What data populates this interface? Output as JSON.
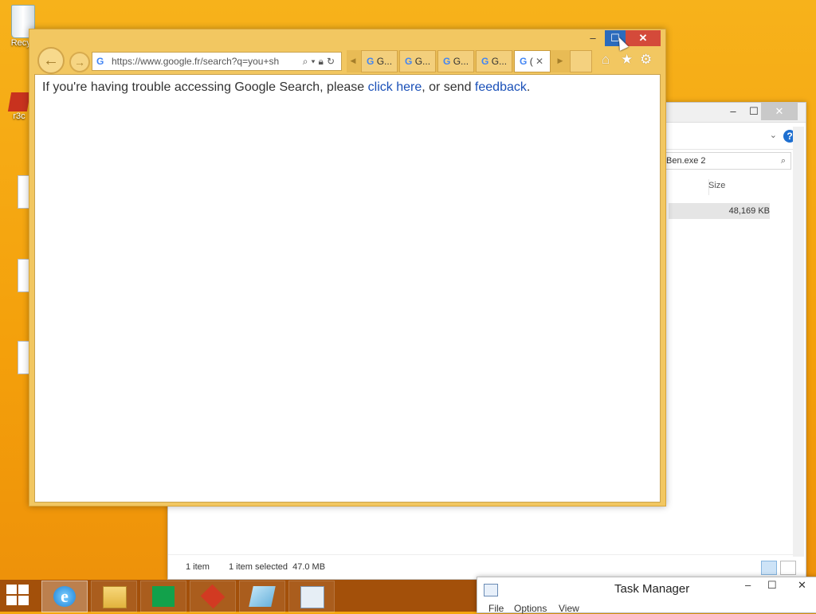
{
  "desktop": {
    "recycle_label": "Recyc",
    "app_label": "r3c"
  },
  "explorer": {
    "search_value": "Ben.exe 2",
    "column_size_header": "Size",
    "selected_size": "48,169 KB",
    "status_items": "1 item",
    "status_selected": "1 item selected  47.0 MB",
    "min_label": "–",
    "max_label": "☐",
    "close_label": "✕",
    "help_label": "?"
  },
  "ie": {
    "address_url": "https://www.google.fr/search?q=you+sh",
    "tabs": [
      {
        "label": "G..."
      },
      {
        "label": "G..."
      },
      {
        "label": "G..."
      },
      {
        "label": "G..."
      },
      {
        "label": "(",
        "active": true
      }
    ],
    "message_prefix": "If you're having trouble accessing Google Search, please ",
    "link_click_here": "click here",
    "message_middle": ", or send ",
    "link_feedback": "feedback",
    "message_suffix": ".",
    "min_label": "–",
    "max_label": "☐",
    "close_label": "✕",
    "tab_close_label": "✕"
  },
  "taskbar": {
    "apps": [
      "start",
      "internet-explorer",
      "file-explorer",
      "store",
      "app-red",
      "app-notepad",
      "app-monitor"
    ]
  },
  "taskmanager": {
    "title": "Task Manager",
    "menu": [
      "File",
      "Options",
      "View"
    ],
    "min_label": "–",
    "max_label": "☐",
    "close_label": "✕"
  },
  "colors": {
    "desktop": "#f4a60e",
    "ie_frame": "#f2c761",
    "taskbar": "#a3500a",
    "link": "#1a50b8"
  }
}
